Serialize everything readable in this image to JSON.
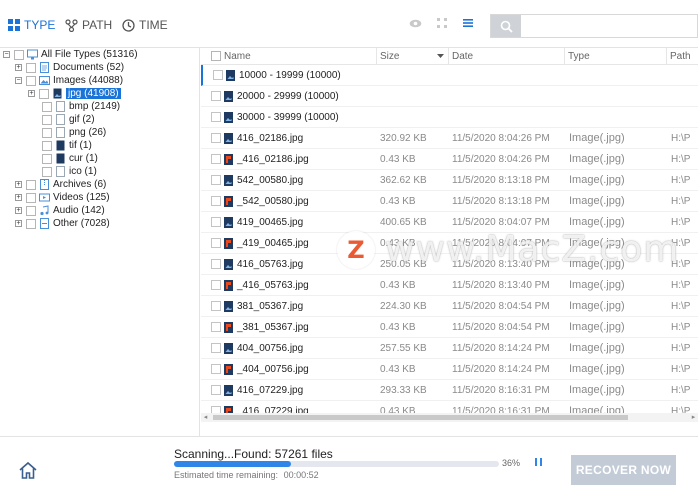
{
  "toolbar": {
    "tabs": [
      {
        "label": "TYPE",
        "icon": "type-grid-icon"
      },
      {
        "label": "PATH",
        "icon": "path-tree-icon"
      },
      {
        "label": "TIME",
        "icon": "clock-icon"
      }
    ],
    "view_icons": [
      "preview-eye-icon",
      "grid-view-icon",
      "list-view-icon"
    ],
    "search": {
      "placeholder": "",
      "value": ""
    }
  },
  "tree": [
    {
      "label": "All File Types (51316)",
      "icon": "monitor-icon",
      "expand": "-"
    },
    {
      "label": "Documents (52)",
      "icon": "document-icon",
      "expand": "+"
    },
    {
      "label": "Images (44088)",
      "icon": "images-icon",
      "expand": "-"
    },
    {
      "label": "jpg (41908)",
      "icon": "jpg-file-icon",
      "expand": "+",
      "selected": true
    },
    {
      "label": "bmp (2149)",
      "icon": "file-icon",
      "expand": ""
    },
    {
      "label": "gif (2)",
      "icon": "file-icon",
      "expand": ""
    },
    {
      "label": "png (26)",
      "icon": "file-icon",
      "expand": ""
    },
    {
      "label": "tif (1)",
      "icon": "file-icon",
      "expand": ""
    },
    {
      "label": "cur (1)",
      "icon": "file-icon",
      "expand": ""
    },
    {
      "label": "ico (1)",
      "icon": "file-icon",
      "expand": ""
    },
    {
      "label": "Archives (6)",
      "icon": "archive-icon",
      "expand": "+"
    },
    {
      "label": "Videos (125)",
      "icon": "video-icon",
      "expand": "+"
    },
    {
      "label": "Audio (142)",
      "icon": "audio-icon",
      "expand": "+"
    },
    {
      "label": "Other (7028)",
      "icon": "other-icon",
      "expand": "+"
    }
  ],
  "columns": {
    "name": "Name",
    "size": "Size",
    "date": "Date",
    "type": "Type",
    "path": "Path"
  },
  "rows": [
    {
      "name": "10000 - 19999 (10000)",
      "size": "",
      "date": "",
      "type": "",
      "path": "",
      "icon": "folder-jpg-icon"
    },
    {
      "name": "20000 - 29999 (10000)",
      "size": "",
      "date": "",
      "type": "",
      "path": "",
      "icon": "folder-jpg-icon"
    },
    {
      "name": "30000 - 39999 (10000)",
      "size": "",
      "date": "",
      "type": "",
      "path": "",
      "icon": "folder-jpg-icon"
    },
    {
      "name": "416_02186.jpg",
      "size": "320.92 KB",
      "date": "11/5/2020 8:04:26 PM",
      "type": "Image(.jpg)",
      "path": "H:\\P",
      "icon": "jpg-file-icon"
    },
    {
      "name": "_416_02186.jpg",
      "size": "0.43 KB",
      "date": "11/5/2020 8:04:26 PM",
      "type": "Image(.jpg)",
      "path": "H:\\P",
      "icon": "jpg-damaged-icon"
    },
    {
      "name": "542_00580.jpg",
      "size": "362.62 KB",
      "date": "11/5/2020 8:13:18 PM",
      "type": "Image(.jpg)",
      "path": "H:\\P",
      "icon": "jpg-file-icon"
    },
    {
      "name": "_542_00580.jpg",
      "size": "0.43 KB",
      "date": "11/5/2020 8:13:18 PM",
      "type": "Image(.jpg)",
      "path": "H:\\P",
      "icon": "jpg-damaged-icon"
    },
    {
      "name": "419_00465.jpg",
      "size": "400.65 KB",
      "date": "11/5/2020 8:04:07 PM",
      "type": "Image(.jpg)",
      "path": "H:\\P",
      "icon": "jpg-file-icon"
    },
    {
      "name": "_419_00465.jpg",
      "size": "0.43 KB",
      "date": "11/5/2020 8:04:07 PM",
      "type": "Image(.jpg)",
      "path": "H:\\P",
      "icon": "jpg-damaged-icon"
    },
    {
      "name": "416_05763.jpg",
      "size": "250.05 KB",
      "date": "11/5/2020 8:13:40 PM",
      "type": "Image(.jpg)",
      "path": "H:\\P",
      "icon": "jpg-file-icon"
    },
    {
      "name": "_416_05763.jpg",
      "size": "0.43 KB",
      "date": "11/5/2020 8:13:40 PM",
      "type": "Image(.jpg)",
      "path": "H:\\P",
      "icon": "jpg-damaged-icon"
    },
    {
      "name": "381_05367.jpg",
      "size": "224.30 KB",
      "date": "11/5/2020 8:04:54 PM",
      "type": "Image(.jpg)",
      "path": "H:\\P",
      "icon": "jpg-file-icon"
    },
    {
      "name": "_381_05367.jpg",
      "size": "0.43 KB",
      "date": "11/5/2020 8:04:54 PM",
      "type": "Image(.jpg)",
      "path": "H:\\P",
      "icon": "jpg-damaged-icon"
    },
    {
      "name": "404_00756.jpg",
      "size": "257.55 KB",
      "date": "11/5/2020 8:14:24 PM",
      "type": "Image(.jpg)",
      "path": "H:\\P",
      "icon": "jpg-file-icon"
    },
    {
      "name": "_404_00756.jpg",
      "size": "0.43 KB",
      "date": "11/5/2020 8:14:24 PM",
      "type": "Image(.jpg)",
      "path": "H:\\P",
      "icon": "jpg-damaged-icon"
    },
    {
      "name": "416_07229.jpg",
      "size": "293.33 KB",
      "date": "11/5/2020 8:16:31 PM",
      "type": "Image(.jpg)",
      "path": "H:\\P",
      "icon": "jpg-file-icon"
    },
    {
      "name": "_416_07229.jpg",
      "size": "0.43 KB",
      "date": "11/5/2020 8:16:31 PM",
      "type": "Image(.jpg)",
      "path": "H:\\P",
      "icon": "jpg-damaged-icon"
    }
  ],
  "watermark": {
    "letter": "Z",
    "text": "www.MacZ.com"
  },
  "status": {
    "scanning": "Scanning...Found: 57261 files",
    "progress_percent": 36,
    "percent_label": "36%",
    "estimated_label": "Estimated time remaining:",
    "estimated_value": "00:00:52"
  },
  "recover_label": "RECOVER NOW",
  "colors": {
    "accent": "#1a73d9",
    "progress": "#2f86e8",
    "recover_disabled": "#c2cbd6"
  }
}
